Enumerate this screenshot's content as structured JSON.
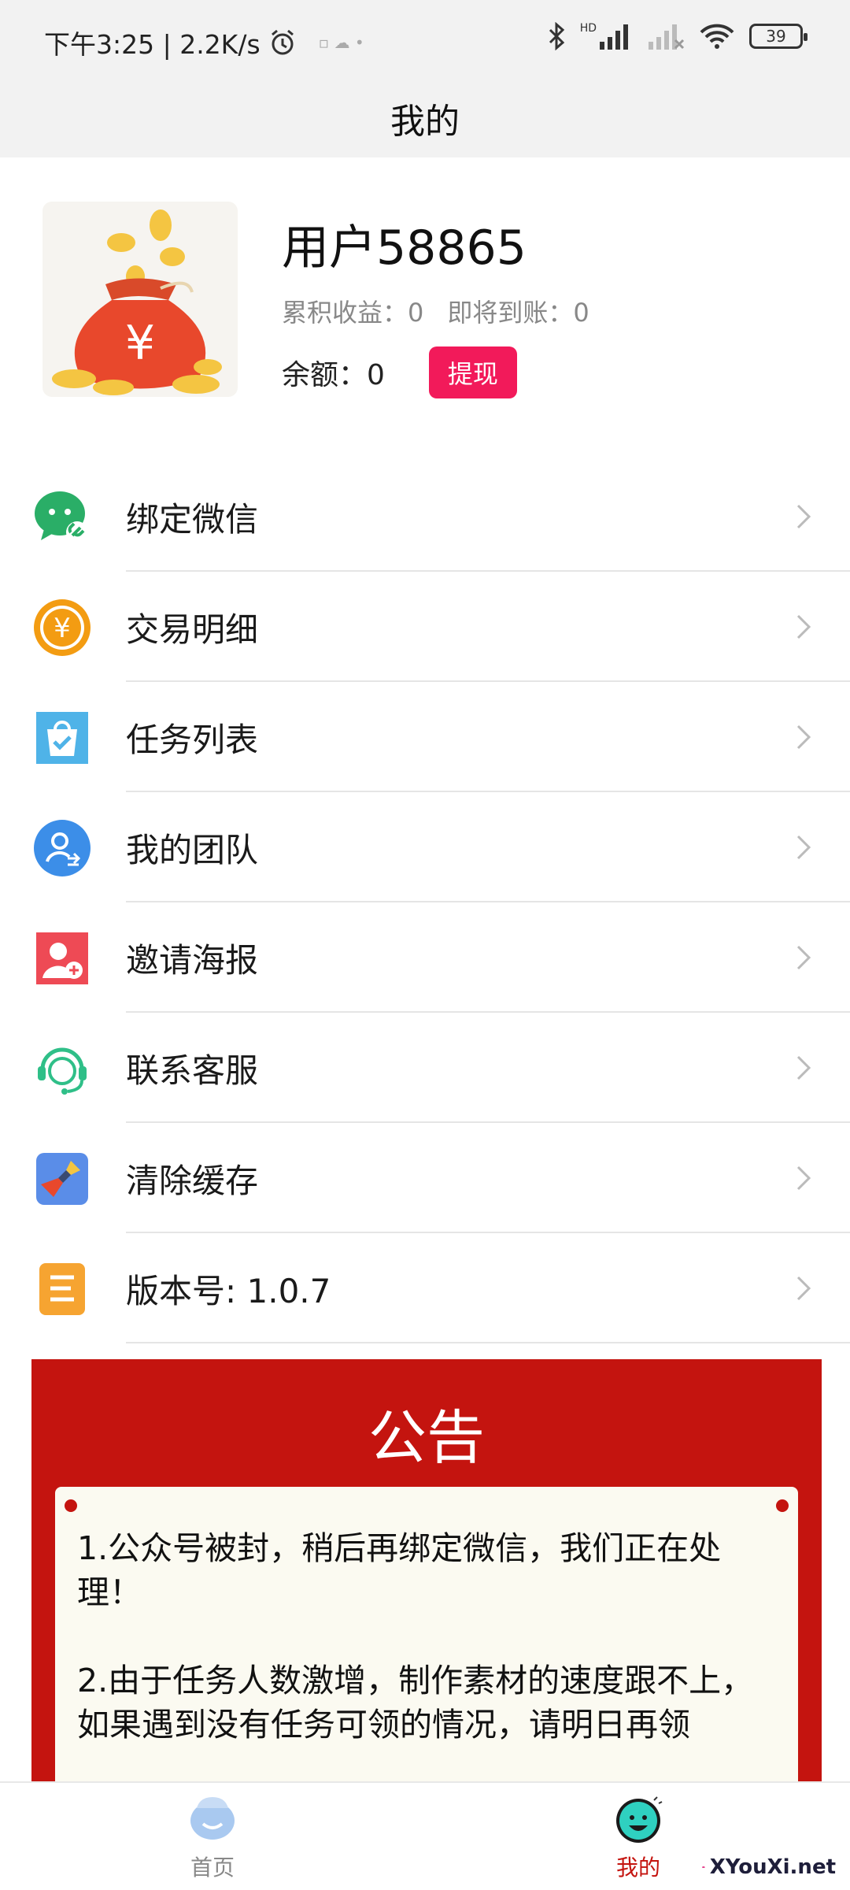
{
  "status_bar": {
    "time_speed": "下午3:25 | 2.2K/s",
    "network_label": "HD",
    "battery": "39"
  },
  "title": "我的",
  "profile": {
    "username": "用户58865",
    "cumulative_earnings": "累积收益：0",
    "pending_earnings": "即将到账：0",
    "balance": "余额：0",
    "withdraw_label": "提现"
  },
  "menu": [
    {
      "label": "绑定微信",
      "icon": "wechat-link-icon"
    },
    {
      "label": "交易明细",
      "icon": "yuan-coin-icon"
    },
    {
      "label": "任务列表",
      "icon": "task-bag-icon"
    },
    {
      "label": "我的团队",
      "icon": "team-user-icon"
    },
    {
      "label": "邀请海报",
      "icon": "invite-user-icon"
    },
    {
      "label": "联系客服",
      "icon": "customer-service-icon"
    },
    {
      "label": "清除缓存",
      "icon": "broom-icon"
    },
    {
      "label": "版本号: 1.0.7",
      "icon": "version-doc-icon"
    }
  ],
  "notice": {
    "title": "公告",
    "paragraphs": [
      "1.公众号被封，稍后再绑定微信，我们正在处理！",
      "2.由于任务人数激增，制作素材的速度跟不上，如果遇到没有任务可领的情况，请明日再领"
    ]
  },
  "tabbar": {
    "home_label": "首页",
    "mine_label": "我的",
    "active_color": "#c4140f",
    "inactive_color": "#888888"
  },
  "watermark": "XYouXi.net",
  "colors": {
    "withdraw": "#f21a5a",
    "notice_bg": "#c4140f"
  }
}
